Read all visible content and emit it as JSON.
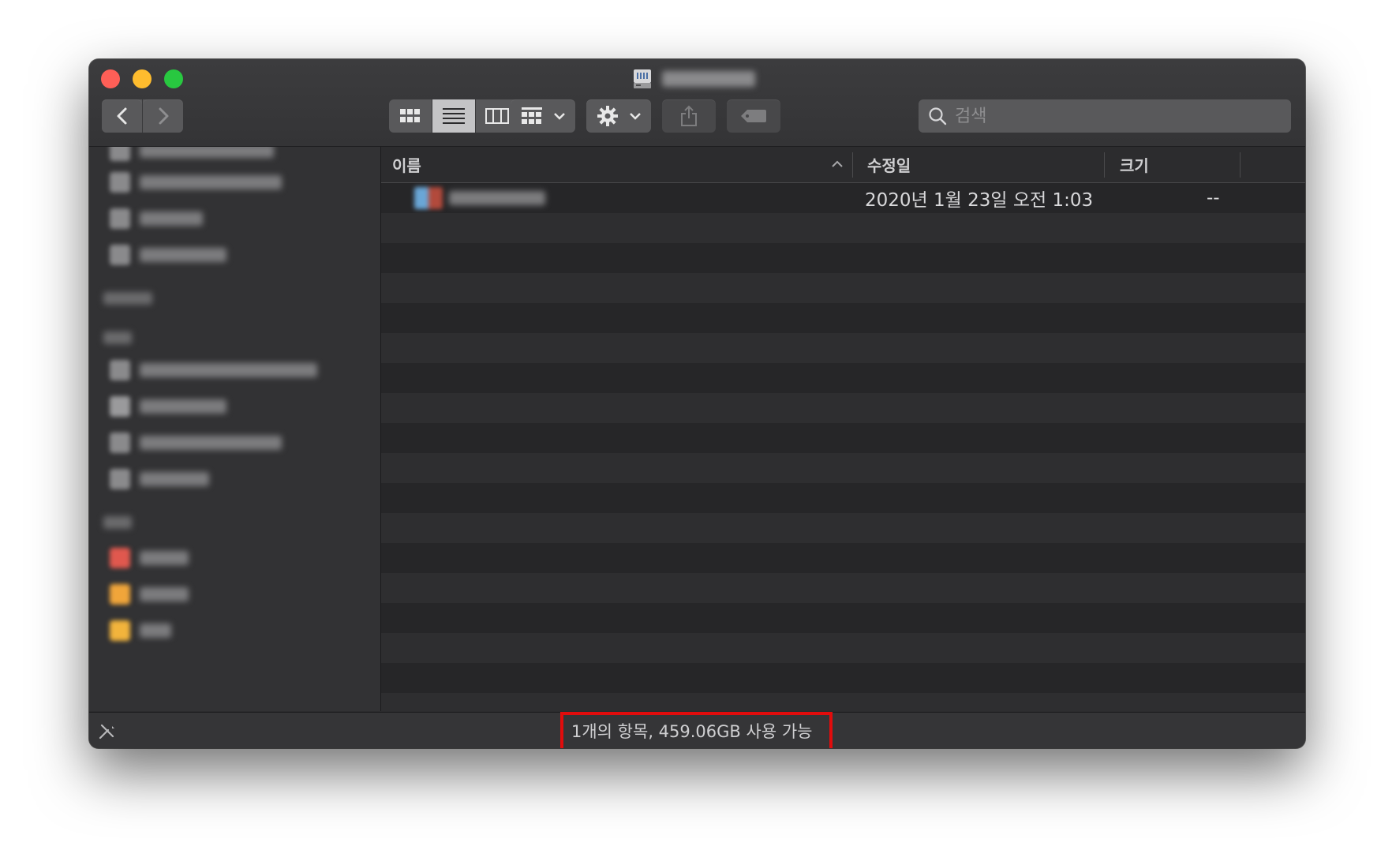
{
  "window": {
    "title": "",
    "icons": {
      "close": "close-light",
      "minimize": "minimize-light",
      "zoom": "zoom-light",
      "drive": "external-drive-icon"
    }
  },
  "toolbar": {
    "back": "chevron-left-icon",
    "forward": "chevron-right-icon",
    "views": [
      "icon-view",
      "list-view",
      "column-view",
      "gallery-view"
    ],
    "selected_view": "list-view",
    "group": "group-grid-icon",
    "action": "gear-icon",
    "share": "share-icon",
    "tag": "tag-icon"
  },
  "search": {
    "placeholder": "검색"
  },
  "columns": {
    "name": "이름",
    "date": "수정일",
    "size": "크기",
    "sort": "ascending"
  },
  "files": [
    {
      "name": "",
      "modified": "2020년 1월 23일 오전 1:03",
      "size": "--"
    }
  ],
  "status": {
    "text": "1개의 항목, 459.06GB 사용 가능"
  },
  "colors": {
    "highlight": "#e10c0c",
    "close": "#fe5f57",
    "minimize": "#febc2e",
    "zoom": "#28c840"
  }
}
